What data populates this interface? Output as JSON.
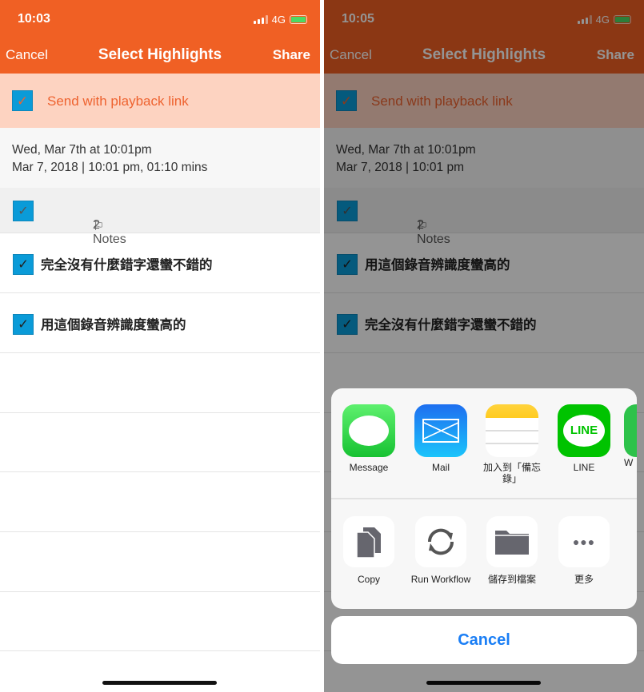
{
  "left": {
    "time": "10:03",
    "network": "4G",
    "nav": {
      "cancel": "Cancel",
      "title": "Select Highlights",
      "share": "Share"
    },
    "playback_label": "Send with playback link",
    "date_line1": "Wed, Mar 7th at 10:01pm",
    "date_line2": "Mar 7, 2018 | 10:01 pm, 01:10 mins",
    "notes_label": "2 Notes",
    "items": [
      "完全沒有什麼錯字還蠻不錯的",
      "用這個錄音辨識度蠻高的"
    ]
  },
  "right": {
    "time": "10:05",
    "network": "4G",
    "nav": {
      "cancel": "Cancel",
      "title": "Select Highlights",
      "share": "Share"
    },
    "playback_label": "Send with playback link",
    "date_line1": "Wed, Mar 7th at 10:01pm",
    "date_line2": "Mar 7, 2018 | 10:01 pm",
    "notes_label": "2 Notes",
    "items": [
      "用這個錄音辨識度蠻高的",
      "完全沒有什麼錯字還蠻不錯的"
    ],
    "share_sheet": {
      "apps": [
        {
          "label": "Message",
          "icon": "messages-icon"
        },
        {
          "label": "Mail",
          "icon": "mail-icon"
        },
        {
          "label": "加入到「備忘錄」",
          "icon": "notes-icon"
        },
        {
          "label": "LINE",
          "icon": "line-icon",
          "icon_text": "LINE"
        },
        {
          "label": "W",
          "icon": "partial-app-icon"
        }
      ],
      "actions": [
        {
          "label": "Copy",
          "icon": "copy-icon"
        },
        {
          "label": "Run Workflow",
          "icon": "workflow-icon"
        },
        {
          "label": "儲存到檔案",
          "icon": "folder-icon"
        },
        {
          "label": "更多",
          "icon": "more-icon"
        }
      ],
      "cancel": "Cancel"
    }
  },
  "colors": {
    "accent": "#f06024",
    "checkbox": "#0a9bd8",
    "link": "#1a7ef5"
  }
}
